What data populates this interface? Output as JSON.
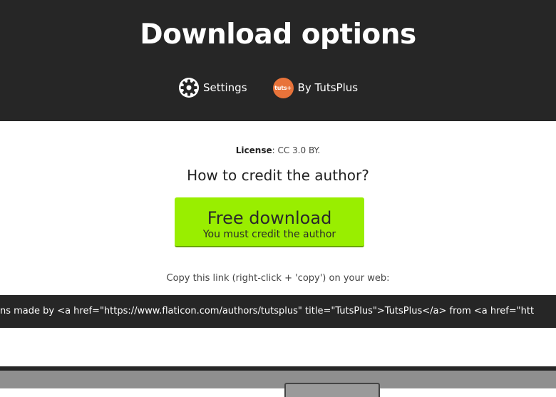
{
  "header": {
    "title": "Download options",
    "settings_label": "Settings",
    "author_label": "By TutsPlus",
    "author_badge_text": "tuts+",
    "author_badge_color": "#e8733a",
    "background": "#262626"
  },
  "content": {
    "license_label": "License",
    "license_value": ": CC 3.0 BY.",
    "credit_question": "How to credit the author?",
    "download_button": {
      "main_label": "Free download",
      "sub_label": "You must credit the author",
      "color": "#99ee00"
    },
    "copy_hint": "Copy this link (right-click + 'copy') on your web:",
    "attribution_code": "ons made by <a href=\"https://www.flaticon.com/authors/tutsplus\" title=\"TutsPlus\">TutsPlus</a> from <a href=\"htt"
  },
  "icons": {
    "settings": "gear-icon",
    "author": "tutsplus-logo"
  }
}
